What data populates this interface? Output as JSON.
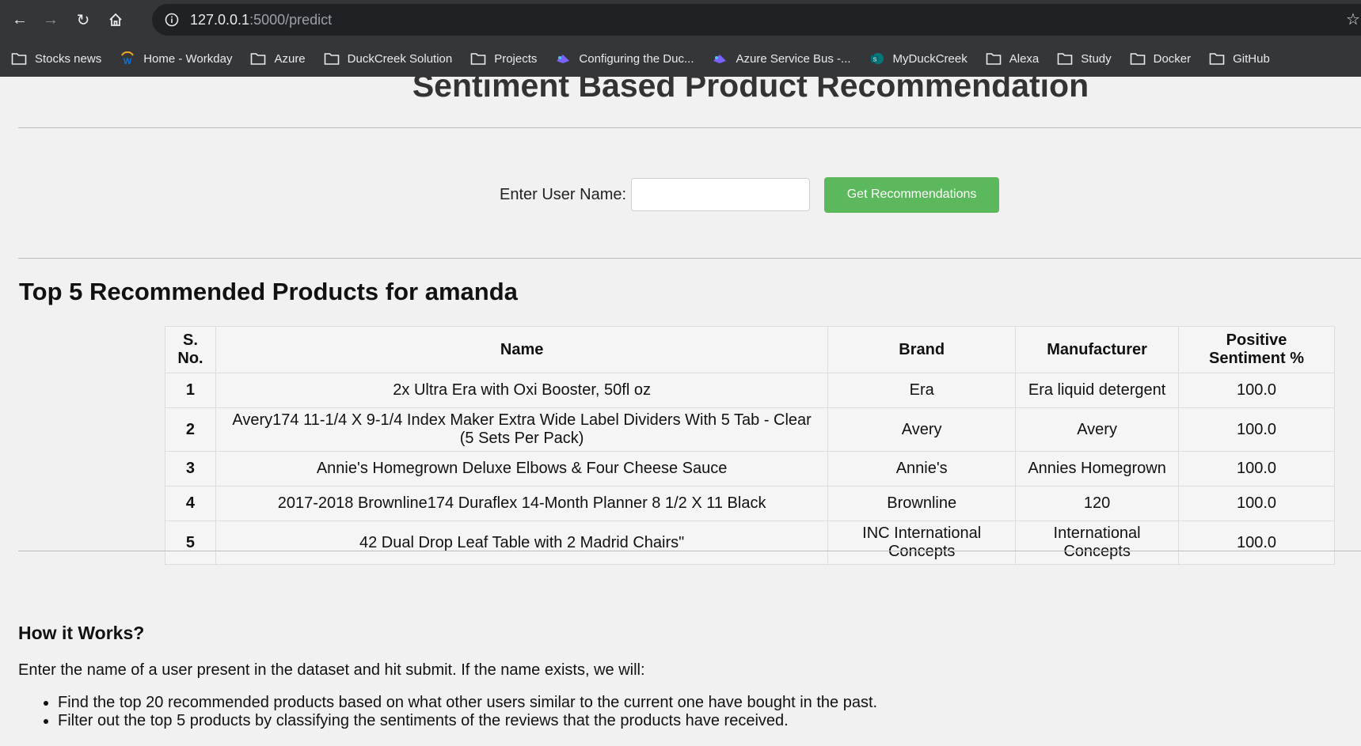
{
  "browser": {
    "url_host": "127.0.0.1",
    "url_path": ":5000/predict",
    "bookmarks": [
      {
        "label": "Stocks news",
        "icon": "folder-icon"
      },
      {
        "label": "Home - Workday",
        "icon": "workday-icon"
      },
      {
        "label": "Azure",
        "icon": "folder-icon"
      },
      {
        "label": "DuckCreek Solution",
        "icon": "folder-icon"
      },
      {
        "label": "Projects",
        "icon": "folder-icon"
      },
      {
        "label": "Configuring the Duc...",
        "icon": "site-icon"
      },
      {
        "label": "Azure Service Bus -...",
        "icon": "site-icon"
      },
      {
        "label": "MyDuckCreek",
        "icon": "sharepoint-icon"
      },
      {
        "label": "Alexa",
        "icon": "folder-icon"
      },
      {
        "label": "Study",
        "icon": "folder-icon"
      },
      {
        "label": "Docker",
        "icon": "folder-icon"
      },
      {
        "label": "GitHub",
        "icon": "folder-icon"
      }
    ]
  },
  "page": {
    "title": "Sentiment Based Product Recommendation",
    "form": {
      "label": "Enter User Name:",
      "input_value": "",
      "button_label": "Get Recommendations"
    },
    "results_title": "Top 5 Recommended Products for amanda",
    "table": {
      "headers": [
        "S. No.",
        "Name",
        "Brand",
        "Manufacturer",
        "Positive Sentiment %"
      ],
      "rows": [
        [
          "1",
          "2x Ultra Era with Oxi Booster, 50fl oz",
          "Era",
          "Era liquid detergent",
          "100.0"
        ],
        [
          "2",
          "Avery174 11-1/4 X 9-1/4 Index Maker Extra Wide Label Dividers With 5 Tab - Clear (5 Sets Per Pack)",
          "Avery",
          "Avery",
          "100.0"
        ],
        [
          "3",
          "Annie's Homegrown Deluxe Elbows & Four Cheese Sauce",
          "Annie's",
          "Annies Homegrown",
          "100.0"
        ],
        [
          "4",
          "2017-2018 Brownline174 Duraflex 14-Month Planner 8 1/2 X 11 Black",
          "Brownline",
          "120",
          "100.0"
        ],
        [
          "5",
          "42 Dual Drop Leaf Table with 2 Madrid Chairs\"",
          "INC International Concepts",
          "International Concepts",
          "100.0"
        ]
      ]
    },
    "how": {
      "title": "How it Works?",
      "intro": "Enter the name of a user present in the dataset and hit submit. If the name exists, we will:",
      "steps": [
        "Find the top 20 recommended products based on what other users similar to the current one have bought in the past.",
        "Filter out the top 5 products by classifying the sentiments of the reviews that the products have received."
      ]
    }
  },
  "colors": {
    "chrome_bg": "#35363a",
    "omnibox_bg": "#202124",
    "page_bg": "#f1f1f1",
    "button_green": "#5cb85c"
  }
}
